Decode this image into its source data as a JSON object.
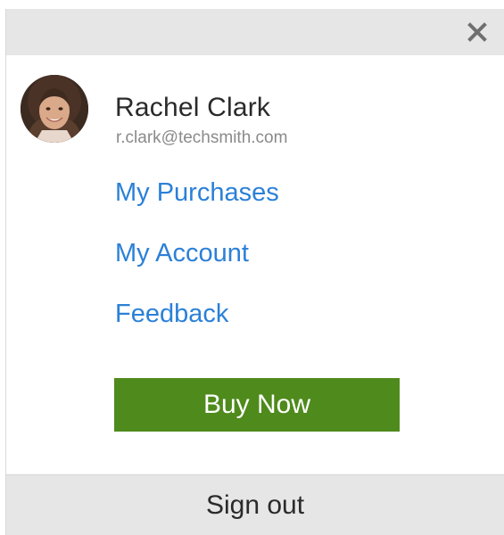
{
  "header": {
    "close_icon": "close-icon"
  },
  "user": {
    "name": "Rachel Clark",
    "email": "r.clark@techsmith.com",
    "avatar_icon": "user-avatar-photo"
  },
  "menu": {
    "items": [
      {
        "label": "My Purchases"
      },
      {
        "label": "My Account"
      },
      {
        "label": "Feedback"
      }
    ]
  },
  "actions": {
    "buy_label": "Buy Now",
    "buy_color": "#4f8a1c"
  },
  "footer": {
    "signout_label": "Sign out"
  },
  "colors": {
    "link": "#2b80d8",
    "bar_background": "#e6e6e6"
  }
}
